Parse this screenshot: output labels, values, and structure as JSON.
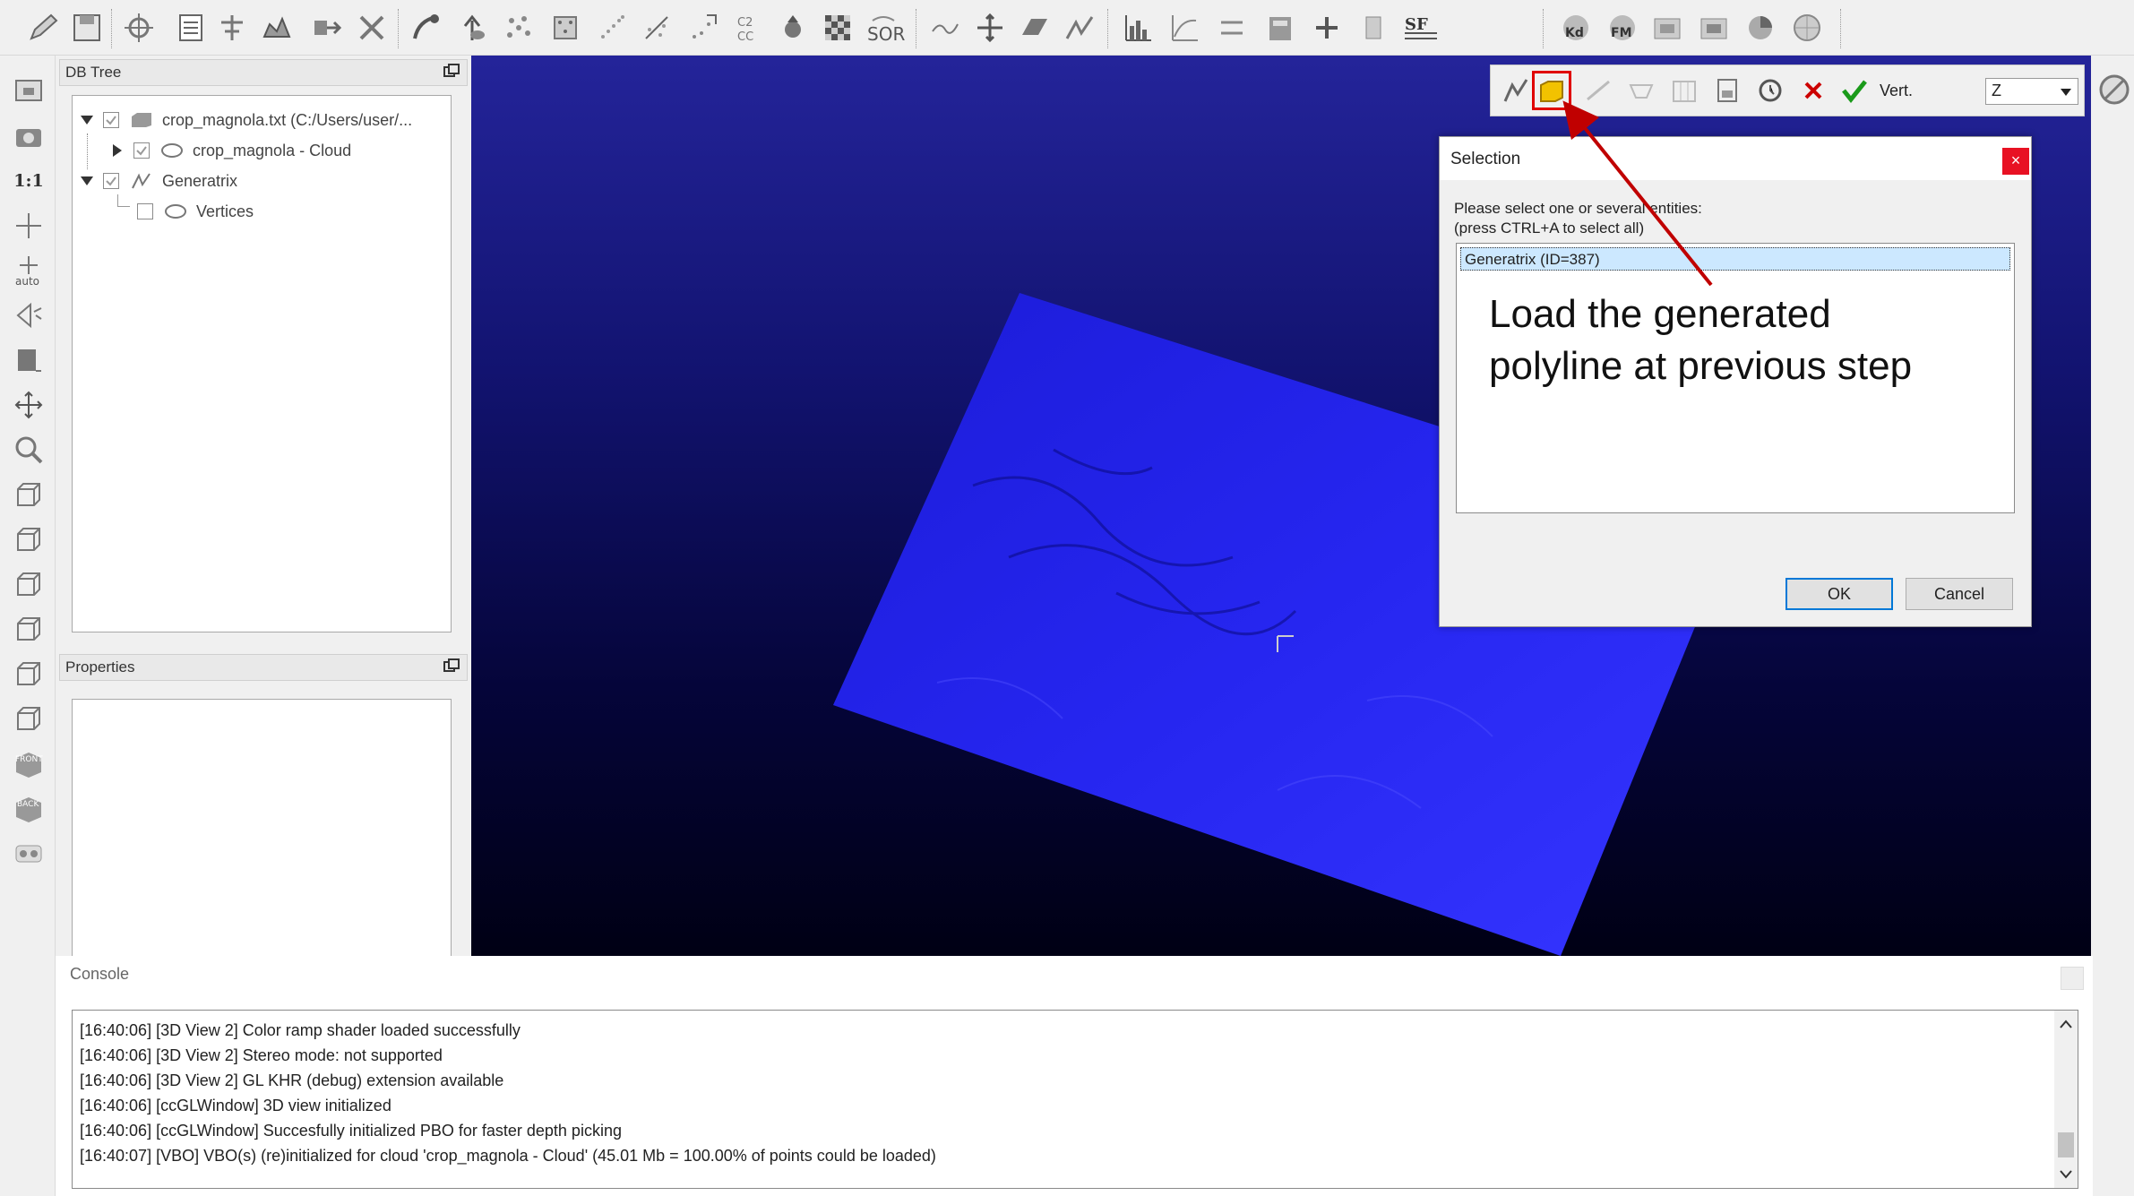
{
  "toolbar": {
    "icons": [
      "edit-icon",
      "save-icon",
      "transform-icon",
      "list-icon",
      "sample-icon",
      "crop-icon",
      "export-icon",
      "delete-icon",
      "merge-icon",
      "normal-icon",
      "scatter-icon",
      "mesh-icon",
      "subsample-icon",
      "noise-icon",
      "fit-icon",
      "compare-icon",
      "sphere-icon",
      "checker-icon",
      "sor-icon",
      "filter-icon",
      "translate-icon",
      "plane-icon",
      "polyline-icon",
      "histogram-icon",
      "graph-icon",
      "stats-icon",
      "calc-icon",
      "plus-icon",
      "calculator-icon",
      "sf-icon",
      "kd-icon",
      "fm-icon",
      "window-icon",
      "window-icon-2",
      "color-icon",
      "sphere-icon-2"
    ],
    "sor_label": "SOR",
    "sf_label": "SF",
    "kd_label": "Kd",
    "fm_label": "FM"
  },
  "db_tree": {
    "title": "DB Tree",
    "items": [
      {
        "label": "crop_magnola.txt (C:/Users/user/..."
      },
      {
        "label": "crop_magnola - Cloud"
      },
      {
        "label": "Generatrix"
      },
      {
        "label": "Vertices"
      }
    ]
  },
  "properties": {
    "title": "Properties"
  },
  "left_toolbar": {
    "scale_label": "1:1",
    "auto_label": "auto",
    "front_label": "FRONT",
    "back_label": "BACK"
  },
  "segment_toolbar": {
    "vert_label": "Vert.",
    "axis_value": "Z"
  },
  "dialog": {
    "title": "Selection",
    "close": "×",
    "instruction_1": "Please select one or several entities:",
    "instruction_2": "(press CTRL+A to select all)",
    "entity": "Generatrix (ID=387)",
    "ok": "OK",
    "cancel": "Cancel"
  },
  "annotation": {
    "line_1": "Load the generated",
    "line_2": "polyline at previous step"
  },
  "console": {
    "title": "Console",
    "lines": [
      "[16:40:06] [3D View 2] Color ramp shader loaded successfully",
      "[16:40:06] [3D View 2] Stereo mode: not supported",
      "[16:40:06] [3D View 2] GL KHR (debug) extension available",
      "[16:40:06] [ccGLWindow] 3D view initialized",
      "[16:40:06] [ccGLWindow] Succesfully initialized PBO for faster depth picking",
      "[16:40:07] [VBO] VBO(s) (re)initialized for cloud 'crop_magnola - Cloud' (45.01 Mb = 100.00% of points could be loaded)"
    ]
  },
  "colors": {
    "highlight": "#e00000",
    "selection": "#cce8ff",
    "close_red": "#e81123",
    "cloud_blue": "#2b2bff"
  }
}
